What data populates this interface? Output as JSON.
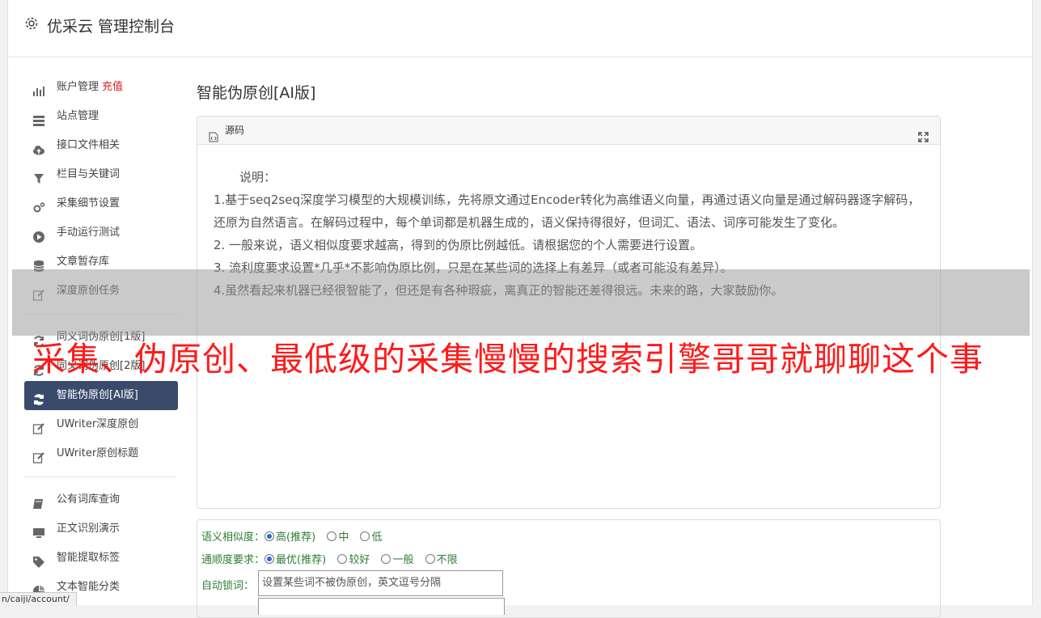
{
  "header": {
    "title": "优采云 管理控制台"
  },
  "sidebar": {
    "recharge": "充值",
    "items": [
      {
        "label": "账户管理"
      },
      {
        "label": "站点管理"
      },
      {
        "label": "接口文件相关"
      },
      {
        "label": "栏目与关键词"
      },
      {
        "label": "采集细节设置"
      },
      {
        "label": "手动运行测试"
      },
      {
        "label": "文章暂存库"
      },
      {
        "label": "深度原创任务"
      },
      {
        "label": "同义词伪原创[1版]"
      },
      {
        "label": "同义词伪原创[2版]"
      },
      {
        "label": "智能伪原创[AI版]"
      },
      {
        "label": "UWriter深度原创"
      },
      {
        "label": "UWriter原创标题"
      },
      {
        "label": "公有词库查询"
      },
      {
        "label": "正文识别演示"
      },
      {
        "label": "智能提取标签"
      },
      {
        "label": "文本智能分类"
      }
    ]
  },
  "main": {
    "title": "智能伪原创[AI版]",
    "panel_title": "源码",
    "intro": "说明：",
    "lines": [
      "1.基于seq2seq深度学习模型的大规模训练，先将原文通过Encoder转化为高维语义向量，再通过语义向量是通过解码器逐字解码，还原为自然语言。在解码过程中，每个单词都是机器生成的，语义保持得很好，但词汇、语法、词序可能发生了变化。",
      "2. 一般来说，语义相似度要求越高，得到的伪原比例越低。请根据您的个人需要进行设置。",
      "3. 流利度要求设置*几乎*不影响伪原比例，只是在某些词的选择上有差异（或者可能没有差异）。",
      "4.虽然看起来机器已经很智能了，但还是有各种瑕疵，离真正的智能还差得很远。未来的路，大家鼓励你。"
    ]
  },
  "form": {
    "similarity_label": "语义相似度：",
    "similarity_options": [
      "高(推荐)",
      "中",
      "低"
    ],
    "fluency_label": "通顺度要求：",
    "fluency_options": [
      "最优(推荐)",
      "较好",
      "一般",
      "不限"
    ],
    "lock_label": "自动锁词：",
    "lock_placeholder": "设置某些词不被伪原创，英文逗号分隔"
  },
  "overlay": {
    "headline": "采集、伪原创、最低级的采集慢慢的搜索引擎哥哥就聊聊这个事"
  },
  "status_bar": {
    "url": "n/caiji/account/"
  }
}
